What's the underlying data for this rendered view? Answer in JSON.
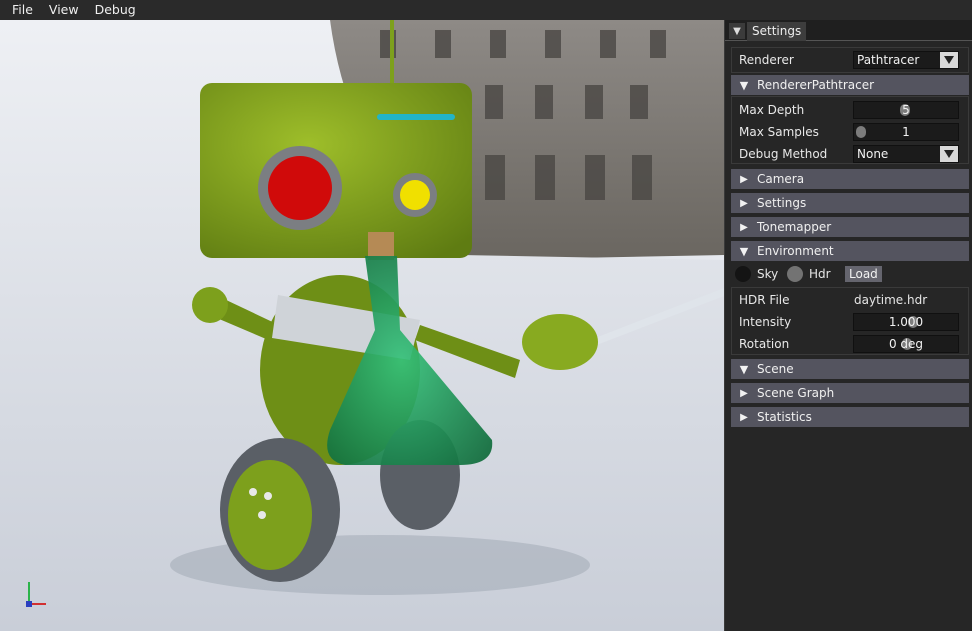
{
  "menu": [
    "File",
    "View",
    "Debug"
  ],
  "panel": {
    "tab_label": "Settings",
    "renderer_label": "Renderer",
    "renderer_value": "Pathtracer",
    "pathtracer_header": "RendererPathtracer",
    "max_depth_label": "Max Depth",
    "max_depth_value": "5",
    "max_samples_label": "Max Samples",
    "max_samples_value": "1",
    "debug_method_label": "Debug Method",
    "debug_method_value": "None",
    "camera_header": "Camera",
    "settings_header": "Settings",
    "tonemapper_header": "Tonemapper",
    "environment_header": "Environment",
    "sky_label": "Sky",
    "hdr_label": "Hdr",
    "load_label": "Load",
    "hdr_file_label": "HDR File",
    "hdr_file_value": "daytime.hdr",
    "intensity_label": "Intensity",
    "intensity_value": "1.000",
    "rotation_label": "Rotation",
    "rotation_value": "0 deg",
    "scene_header": "Scene",
    "scene_graph_header": "Scene Graph",
    "statistics_header": "Statistics"
  },
  "icons": {
    "panel_toggle": "collapse-triangle-icon",
    "expanded": "triangle-down-icon",
    "collapsed": "triangle-right-icon",
    "axis_gizmo": "axis-gizmo-icon"
  },
  "colors": {
    "header_bg": "#54545f",
    "robot_green": "#7da01c",
    "flask_green": "#1e9a5c"
  }
}
